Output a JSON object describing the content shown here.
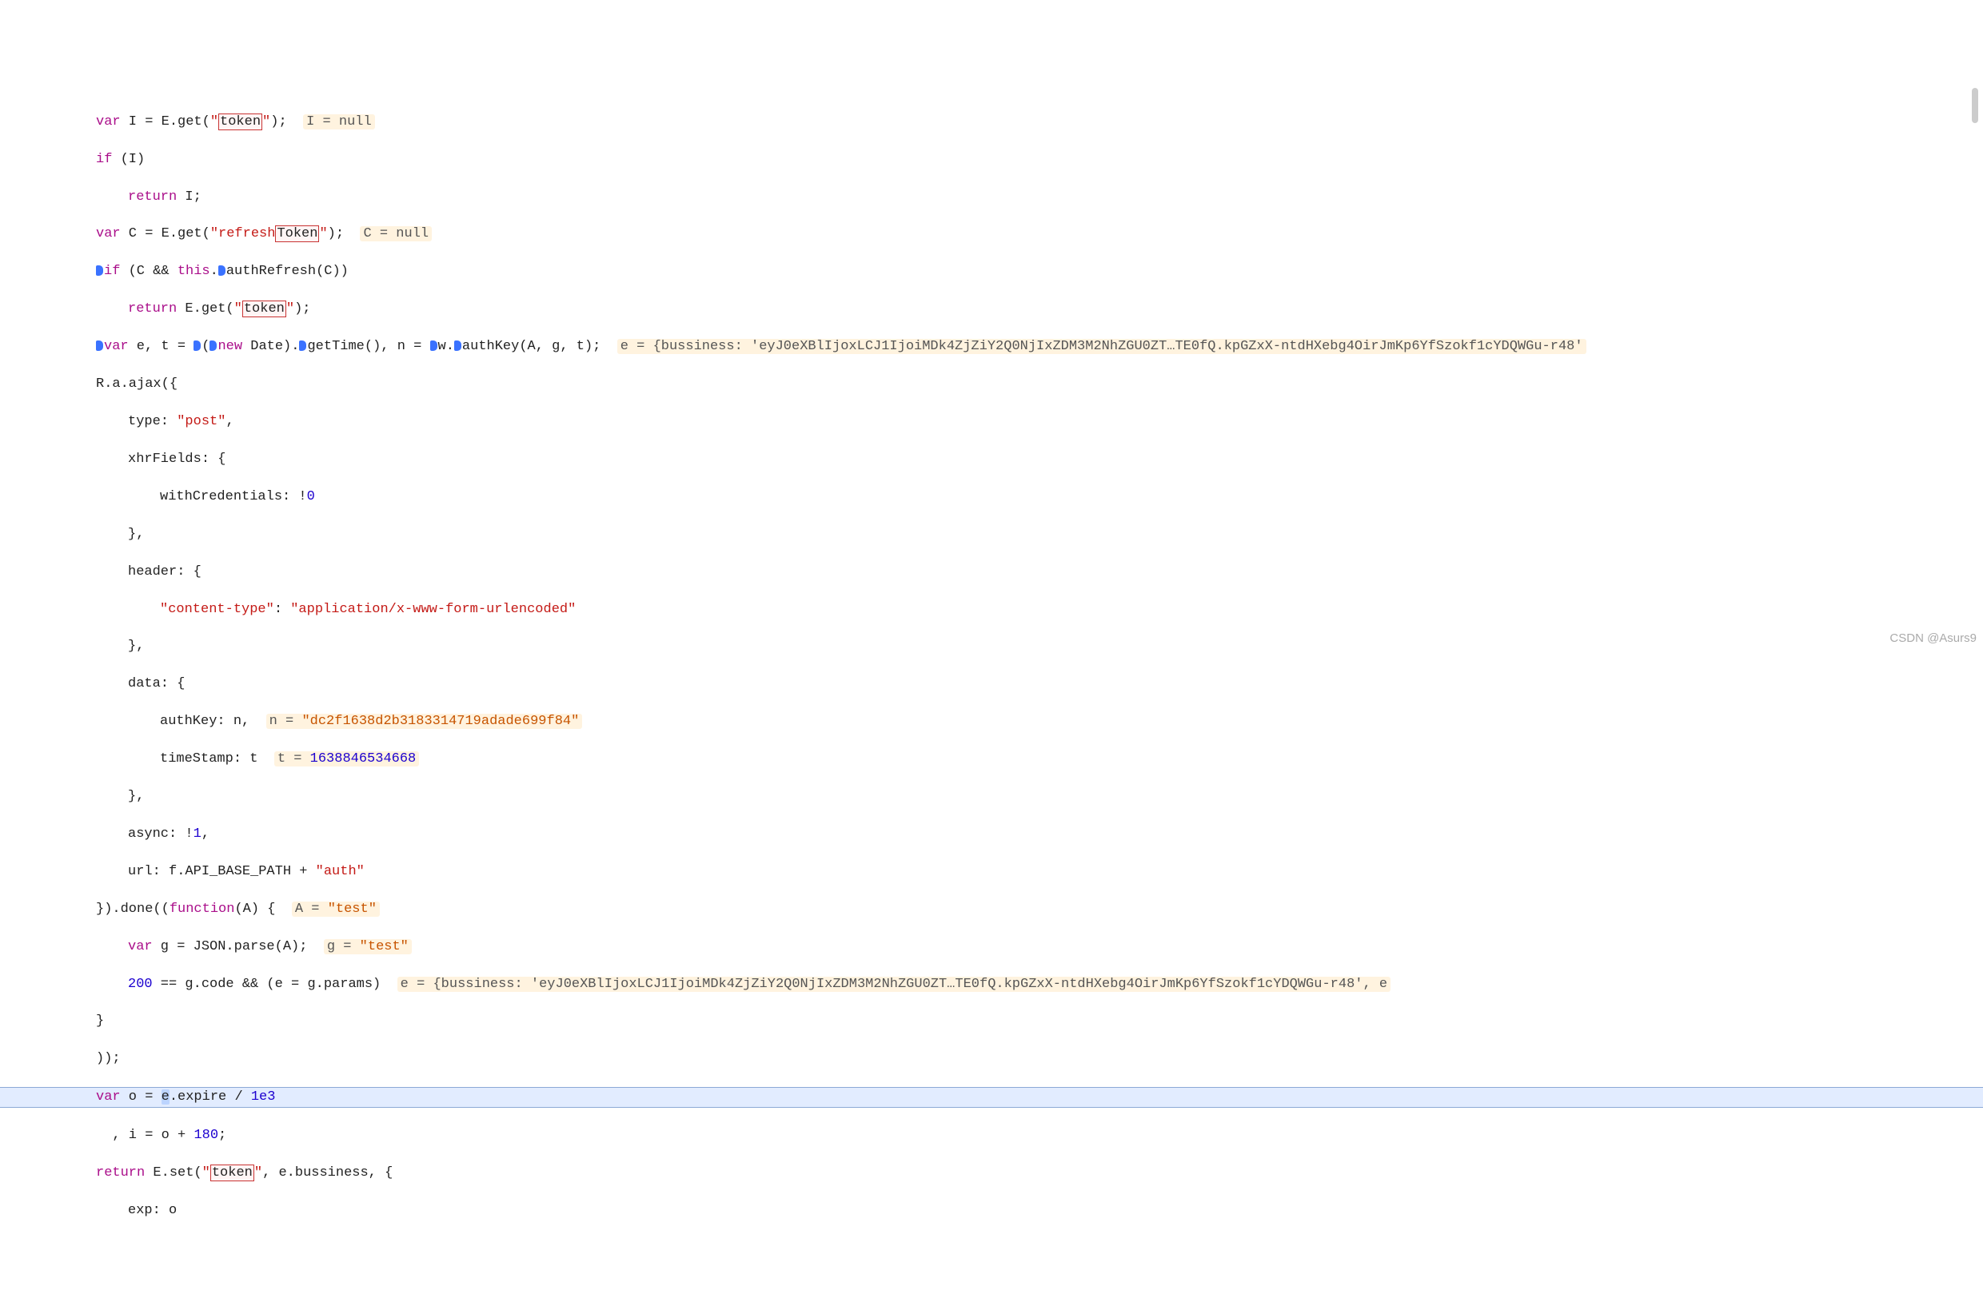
{
  "watermark": "CSDN @Asurs9",
  "code": {
    "l01a_kw1": "var",
    "l01a_txt": " I = E.get(",
    "l01a_str": "\"",
    "l01a_tok": "token",
    "l01a_str2": "\"",
    "l01a_txt2": ");  ",
    "l01a_inl": "I = null",
    "l02_kw": "if",
    "l02_txt": " (I)",
    "l03_kw": "return",
    "l03_txt": " I;",
    "l04_kw": "var",
    "l04_txt": " C = E.get(",
    "l04_str": "\"refresh",
    "l04_tok": "Token",
    "l04_str2": "\"",
    "l04_txt2": ");  ",
    "l04_inl": "C = null",
    "l05_kw": "if",
    "l05_txt1": " (C && ",
    "l05_kw2": "this",
    "l05_txt2": ".",
    "l05_fn": "authRefresh",
    "l05_txt3": "(C))",
    "l06_kw": "return",
    "l06_txt": " E.get(",
    "l06_str": "\"",
    "l06_tok": "token",
    "l06_str2": "\"",
    "l06_txt2": ");",
    "l07_kw": "var",
    "l07_txt1": " e, t = ",
    "l07_paren": "(",
    "l07_kw2": "new",
    "l07_txt2": " Date).",
    "l07_fn": "getTime",
    "l07_txt3": "(), n = ",
    "l07_obj": "w.",
    "l07_fn2": "authKey",
    "l07_txt4": "(A, g, t);  ",
    "l07_inl": "e = {bussiness: 'eyJ0eXBlIjoxLCJ1IjoiMDk4ZjZiY2Q0NjIxZDM3M2NhZGU0ZT…TE0fQ.kpGZxX-ntdHXebg4OirJmKp6YfSzokf1cYDQWGu-r48'",
    "l08_txt": "R.a.ajax({",
    "l09_txt1": "type: ",
    "l09_str": "\"post\"",
    "l09_txt2": ",",
    "l10_txt": "xhrFields: {",
    "l11_txt1": "withCredentials: !",
    "l11_num": "0",
    "l12_txt": "},",
    "l13_txt": "header: {",
    "l14_str1": "\"content-type\"",
    "l14_txt": ": ",
    "l14_str2": "\"application/x-www-form-urlencoded\"",
    "l15_txt": "},",
    "l16_txt": "data: {",
    "l17_txt": "authKey: n,  ",
    "l17_inl_name": "n = ",
    "l17_inl_val": "\"dc2f1638d2b3183314719adade699f84\"",
    "l18_txt": "timeStamp: t  ",
    "l18_inl_name": "t = ",
    "l18_inl_val": "1638846534668",
    "l19_txt": "},",
    "l20_txt1": "async: !",
    "l20_num": "1",
    "l20_txt2": ",",
    "l21_txt1": "url: f.API_BASE_PATH + ",
    "l21_str": "\"auth\"",
    "l22_txt1": "}).done((",
    "l22_kw": "function",
    "l22_txt2": "(A) {  ",
    "l22_inl_name": "A = ",
    "l22_inl_val": "\"test\"",
    "l23_kw": "var",
    "l23_txt": " g = JSON.parse(A);  ",
    "l23_inl_name": "g = ",
    "l23_inl_val": "\"test\"",
    "l24_num": "200",
    "l24_txt": " == g.code && (e = g.params)  ",
    "l24_inl": "e = {bussiness: 'eyJ0eXBlIjoxLCJ1IjoiMDk4ZjZiY2Q0NjIxZDM3M2NhZGU0ZT…TE0fQ.kpGZxX-ntdHXebg4OirJmKp6YfSzokf1cYDQWGu-r48', e",
    "l25_txt": "}",
    "l26_txt": "));",
    "l27_kw": "var",
    "l27_txt1": " o = ",
    "l27_hi": "e",
    "l27_txt2": ".expire / ",
    "l27_num": "1e3",
    "l28_txt1": ", i = o + ",
    "l28_num": "180",
    "l28_txt2": ";",
    "l29_kw": "return",
    "l29_txt1": " E.set(",
    "l29_str": "\"",
    "l29_tok": "token",
    "l29_str2": "\"",
    "l29_txt2": ", e.bussiness, {",
    "l30_txt": "exp: o"
  }
}
